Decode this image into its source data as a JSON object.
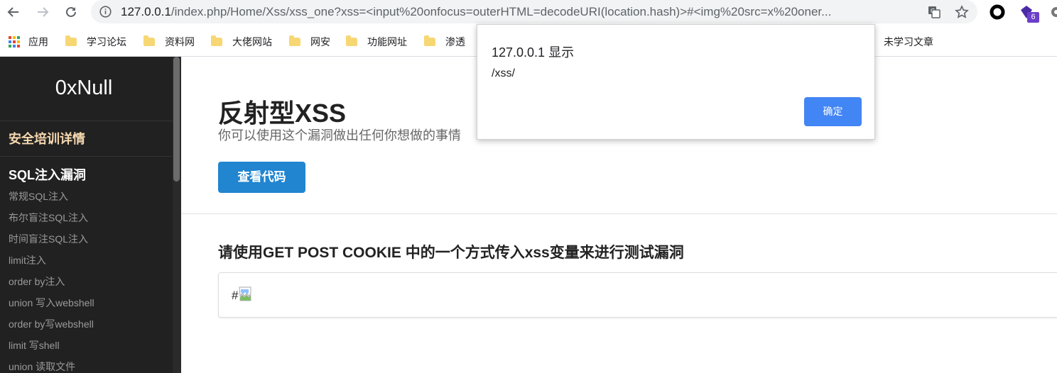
{
  "browser": {
    "url_host": "127.0.0.1",
    "url_path": "/index.php/Home/Xss/xss_one?xss=<input%20onfocus=outerHTML=decodeURI(location.hash)>#<img%20src=x%20oner...",
    "extension_badge": "6"
  },
  "bookmarks": [
    {
      "label": "应用",
      "type": "apps"
    },
    {
      "label": "学习论坛",
      "type": "folder"
    },
    {
      "label": "资料网",
      "type": "folder"
    },
    {
      "label": "大佬网站",
      "type": "folder"
    },
    {
      "label": "网安",
      "type": "folder"
    },
    {
      "label": "功能网址",
      "type": "folder"
    },
    {
      "label": "渗透",
      "type": "folder"
    },
    {
      "label": "未学习文章",
      "type": "folder"
    }
  ],
  "sidebar": {
    "brand": "0xNull",
    "training": "安全培训详情",
    "section": "SQL注入漏洞",
    "items": [
      "常规SQL注入",
      "布尔盲注SQL注入",
      "时间盲注SQL注入",
      "limit注入",
      "order by注入",
      "union 写入webshell",
      "order by写webshell",
      "limit 写shell",
      "union 读取文件"
    ]
  },
  "main": {
    "title": "反射型XSS",
    "subtitle": "你可以使用这个漏洞做出任何你想做的事情",
    "view_code_button": "查看代码",
    "instruction": "请使用GET POST COOKIE 中的一个方式传入xss变量来进行测试漏洞",
    "result_hash": "#"
  },
  "alert": {
    "title": "127.0.0.1 显示",
    "message": "/xss/",
    "ok_label": "确定"
  },
  "colors": {
    "sidebar_bg": "#212121",
    "accent_button": "#2185d0",
    "dialog_button": "#4285f4",
    "training_text": "#f6d8b0"
  }
}
